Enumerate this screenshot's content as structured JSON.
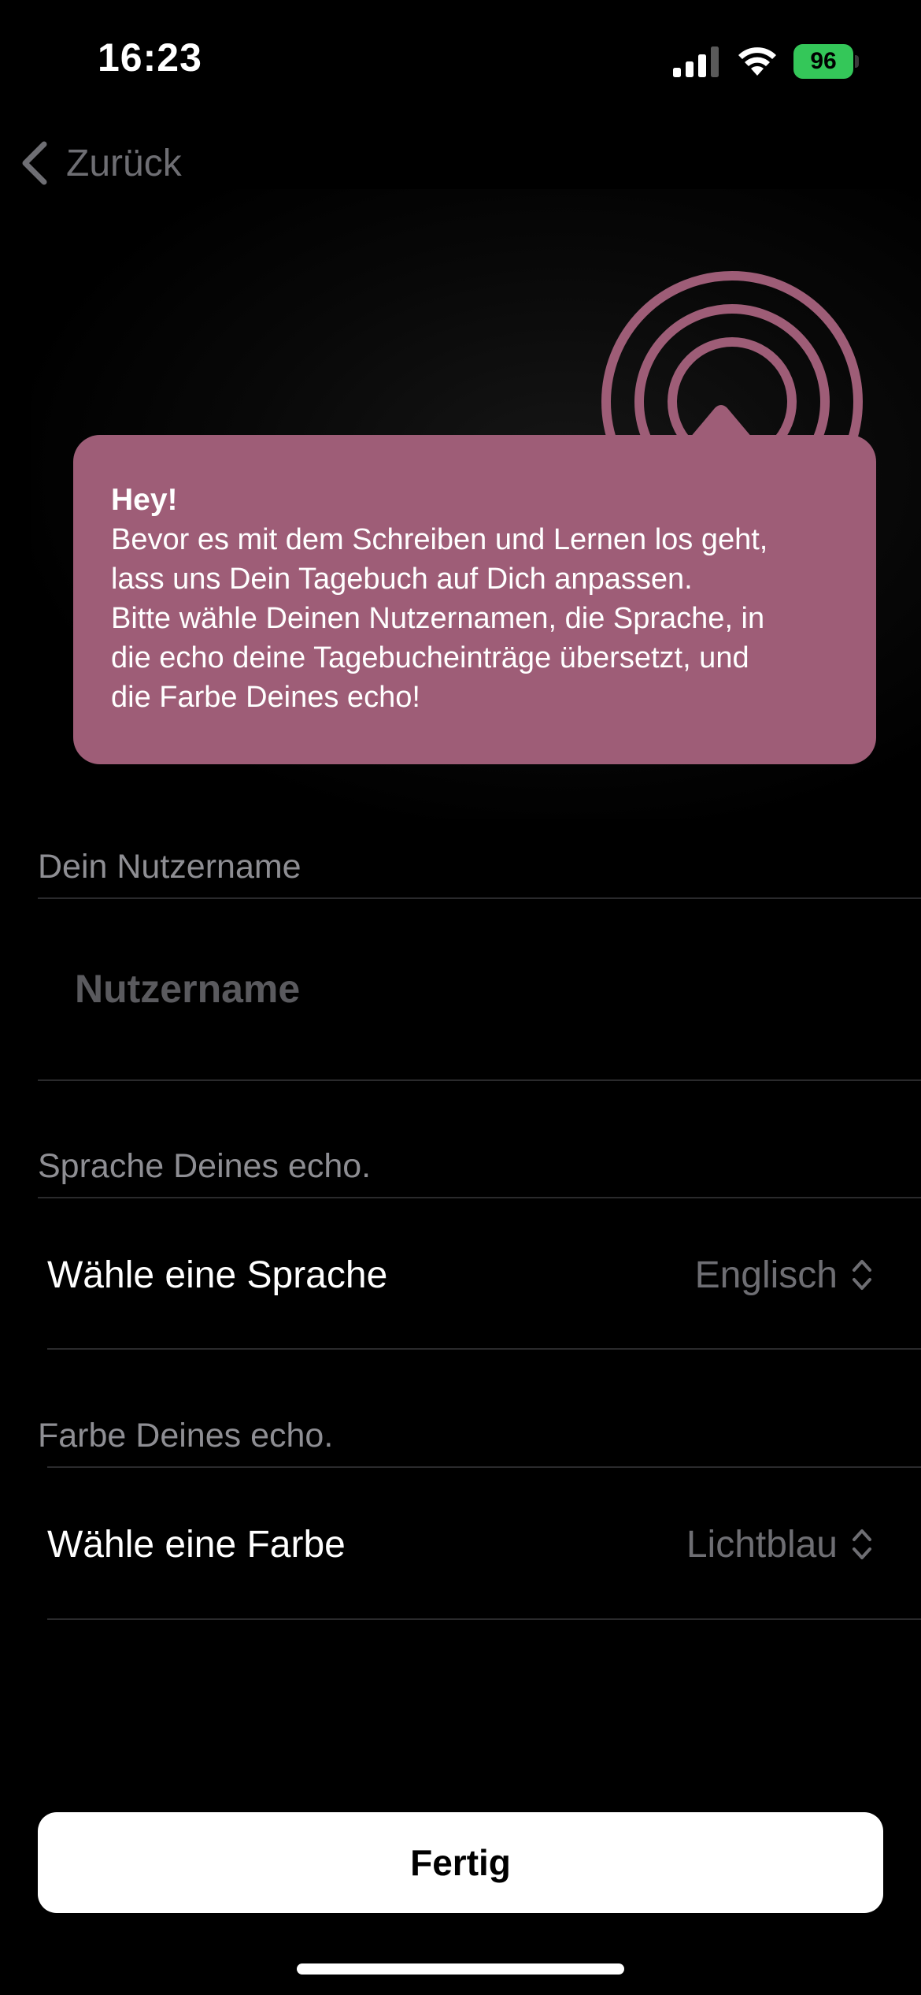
{
  "status_bar": {
    "time": "16:23",
    "battery_level": "96",
    "battery_color": "#34c759"
  },
  "nav": {
    "back_label": "Zurück"
  },
  "tooltip": {
    "title": "Hey!",
    "body": "Bevor es mit dem Schreiben und Lernen los geht,\nlass uns Dein Tagebuch auf Dich anpassen.\nBitte wähle Deinen Nutzernamen, die Sprache, in\ndie echo deine Tagebucheinträge übersetzt, und\ndie Farbe Deines echo!",
    "background_color": "#9e5d77"
  },
  "form": {
    "username_section_label": "Dein Nutzername",
    "username_placeholder": "Nutzername",
    "username_value": "",
    "language_section_label": "Sprache Deines echo.",
    "language_picker_label": "Wähle eine Sprache",
    "language_value": "Englisch",
    "color_section_label": "Farbe Deines echo.",
    "color_picker_label": "Wähle eine Farbe",
    "color_value": "Lichtblau"
  },
  "footer": {
    "done_label": "Fertig"
  },
  "icons": {
    "back": "chevron-left-icon",
    "echo": "echo-rings-icon",
    "picker": "chevron-up-down-icon"
  }
}
